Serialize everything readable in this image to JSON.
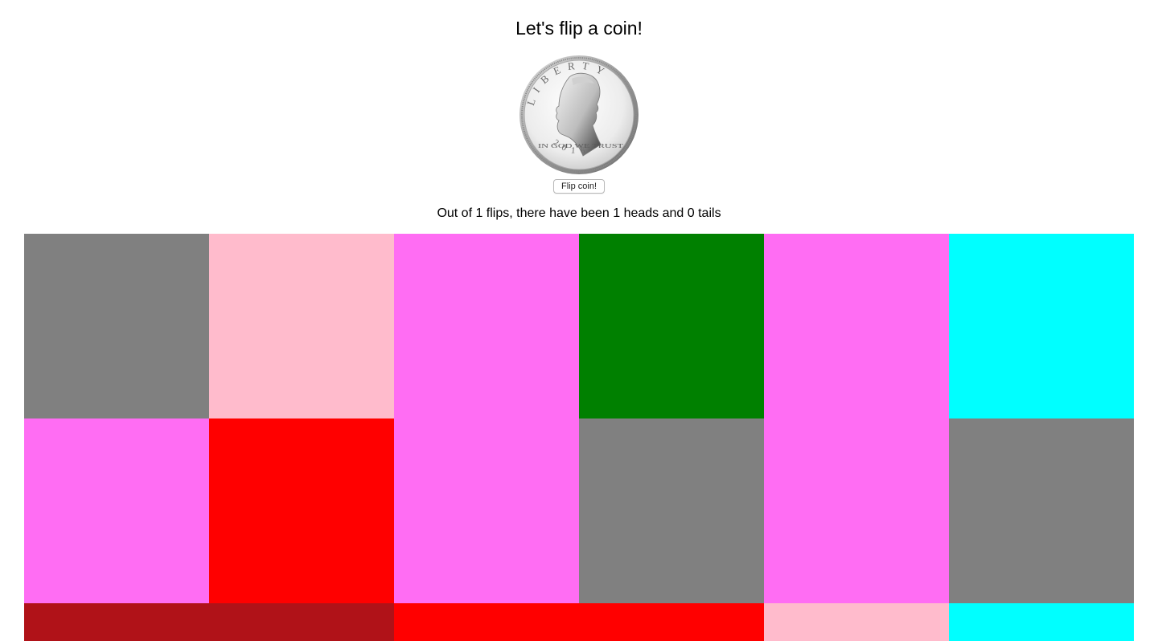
{
  "page": {
    "title": "Let's flip a coin!",
    "flip_button_label": "Flip coin!",
    "stats_text": "Out of 1 flips, there have been 1 heads and 0 tails"
  },
  "coin": {
    "face": "heads",
    "motto": "IN GOD WE TRUST",
    "year": "2016",
    "rim_word": "LIBERTY"
  },
  "tiles": [
    {
      "color": "#808080",
      "col": 1,
      "row": 1,
      "colspan": 1,
      "rowspan": 1
    },
    {
      "color": "#ffbbcc",
      "col": 2,
      "row": 1,
      "colspan": 1,
      "rowspan": 1
    },
    {
      "color": "#ff6df3",
      "col": 3,
      "row": 1,
      "colspan": 1,
      "rowspan": 2
    },
    {
      "color": "#008000",
      "col": 4,
      "row": 1,
      "colspan": 1,
      "rowspan": 1
    },
    {
      "color": "#ff6df3",
      "col": 5,
      "row": 1,
      "colspan": 1,
      "rowspan": 2
    },
    {
      "color": "#00ffff",
      "col": 6,
      "row": 1,
      "colspan": 1,
      "rowspan": 1
    },
    {
      "color": "#ff6df3",
      "col": 1,
      "row": 2,
      "colspan": 1,
      "rowspan": 1
    },
    {
      "color": "#ff0000",
      "col": 2,
      "row": 2,
      "colspan": 1,
      "rowspan": 1
    },
    {
      "color": "#808080",
      "col": 4,
      "row": 2,
      "colspan": 1,
      "rowspan": 1
    },
    {
      "color": "#808080",
      "col": 6,
      "row": 2,
      "colspan": 1,
      "rowspan": 1
    },
    {
      "color": "#b01218",
      "col": 1,
      "row": 3,
      "colspan": 2,
      "rowspan": 1
    },
    {
      "color": "#ff0000",
      "col": 3,
      "row": 3,
      "colspan": 2,
      "rowspan": 1
    },
    {
      "color": "#ffbbcc",
      "col": 5,
      "row": 3,
      "colspan": 1,
      "rowspan": 1
    },
    {
      "color": "#00ffff",
      "col": 6,
      "row": 3,
      "colspan": 1,
      "rowspan": 1
    }
  ]
}
